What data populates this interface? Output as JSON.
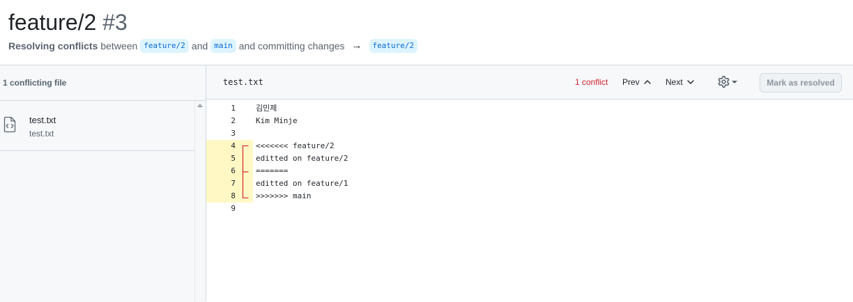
{
  "header": {
    "title": "feature/2",
    "number": "#3",
    "subtitle_strong": "Resolving conflicts",
    "between": "between",
    "branch_head": "feature/2",
    "and": "and",
    "branch_base": "main",
    "committing": "and committing changes",
    "arrow": "→",
    "branch_target": "feature/2"
  },
  "sidebar": {
    "heading": "1 conflicting file",
    "files": [
      {
        "name": "test.txt",
        "path": "test.txt"
      }
    ]
  },
  "toolbar": {
    "filename": "test.txt",
    "conflict_count": "1 conflict",
    "prev_label": "Prev",
    "next_label": "Next",
    "mark_resolved_label": "Mark as resolved"
  },
  "editor": {
    "lines": [
      {
        "num": "1",
        "text": "김민제",
        "conflict": false
      },
      {
        "num": "2",
        "text": "Kim Minje",
        "conflict": false
      },
      {
        "num": "3",
        "text": "",
        "conflict": false
      },
      {
        "num": "4",
        "text": "<<<<<<< feature/2",
        "conflict": true
      },
      {
        "num": "5",
        "text": "editted on feature/2",
        "conflict": true
      },
      {
        "num": "6",
        "text": "=======",
        "conflict": true
      },
      {
        "num": "7",
        "text": "editted on feature/1",
        "conflict": true
      },
      {
        "num": "8",
        "text": ">>>>>>> main",
        "conflict": true
      },
      {
        "num": "9",
        "text": "",
        "conflict": false
      }
    ]
  },
  "icons": {
    "file": "file-code-icon",
    "gear": "gear-icon",
    "prev": "chevron-up-icon",
    "next": "chevron-down-icon"
  },
  "colors": {
    "conflict_text": "#d1242f",
    "conflict_highlight": "#fff8c5",
    "branch_bg": "#ddf4ff",
    "branch_text": "#0969da",
    "bracket": "#d1242f"
  }
}
